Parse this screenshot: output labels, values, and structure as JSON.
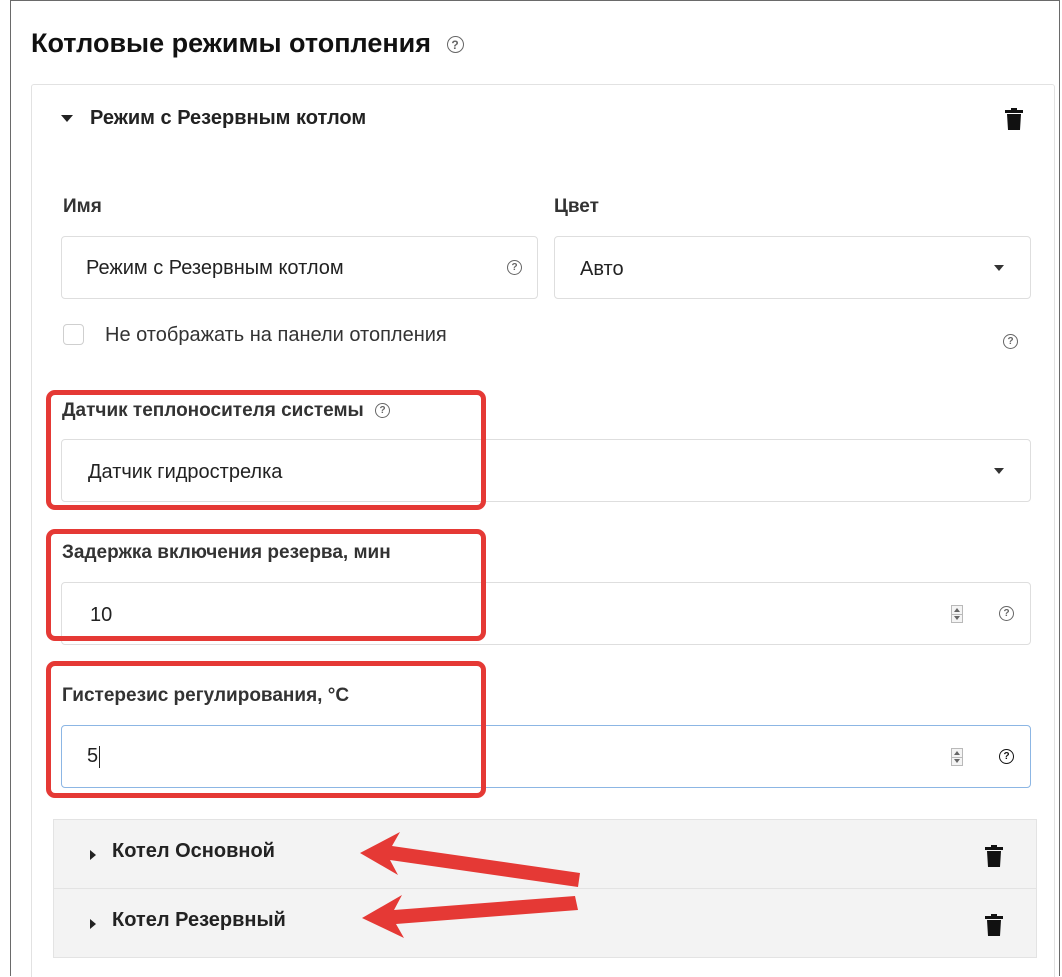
{
  "page": {
    "title": "Котловые режимы отопления",
    "help_glyph": "?"
  },
  "mode": {
    "name": "Режим с Резервным котлом",
    "name_label": "Имя",
    "name_value": "Режим с Резервным котлом",
    "color_label": "Цвет",
    "color_value": "Авто",
    "hide_label": "Не отображать на панели отопления",
    "hide_checked": false,
    "sensor_label": "Датчик теплоносителя системы",
    "sensor_value": "Датчик гидрострелка",
    "delay_label": "Задержка включения резерва, мин",
    "delay_value": "10",
    "hysteresis_label": "Гистерезис регулирования, °C",
    "hysteresis_value": "5"
  },
  "boilers": [
    {
      "name": "Котел Основной"
    },
    {
      "name": "Котел Резервный"
    }
  ],
  "colors": {
    "annotation": "#e53935",
    "focus_border": "#8cb6e4",
    "subpanel_bg": "#f3f3f3"
  },
  "icons": {
    "help": "question-circle-icon",
    "delete": "trash-icon",
    "expand": "caret-icon",
    "dropdown": "chevron-down-icon",
    "annotation": "arrow-icon"
  }
}
